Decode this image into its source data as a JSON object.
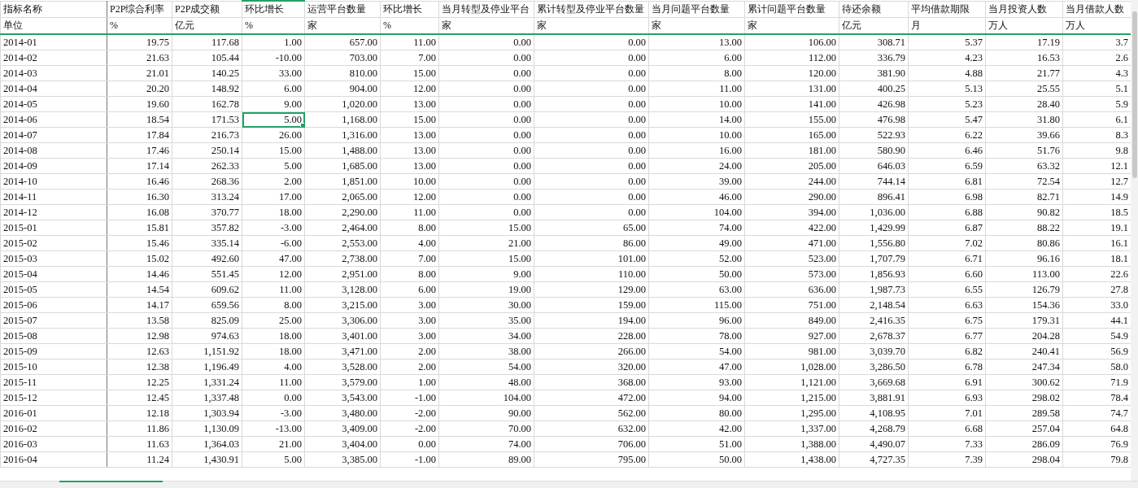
{
  "columns": [
    {
      "name": "指标名称",
      "unit": "单位",
      "selected": false
    },
    {
      "name": "P2P综合利率",
      "unit": "%",
      "selected": false
    },
    {
      "name": "P2P成交额",
      "unit": "亿元",
      "selected": false
    },
    {
      "name": "环比增长",
      "unit": "%",
      "selected": true
    },
    {
      "name": "运营平台数量",
      "unit": "家",
      "selected": false
    },
    {
      "name": "环比增长",
      "unit": "%",
      "selected": false
    },
    {
      "name": "当月转型及停业平台",
      "unit": "家",
      "selected": false
    },
    {
      "name": "累计转型及停业平台数量",
      "unit": "家",
      "selected": false
    },
    {
      "name": "当月问题平台数量",
      "unit": "家",
      "selected": false
    },
    {
      "name": "累计问题平台数量",
      "unit": "家",
      "selected": false
    },
    {
      "name": "待还余额",
      "unit": "亿元",
      "selected": false
    },
    {
      "name": "平均借款期限",
      "unit": "月",
      "selected": false
    },
    {
      "name": "当月投资人数",
      "unit": "万人",
      "selected": false
    },
    {
      "name": "当月借款人数",
      "unit": "万人",
      "selected": false
    }
  ],
  "rows": [
    {
      "selected": false,
      "cells": [
        "2014-01",
        "19.75",
        "117.68",
        "1.00",
        "657.00",
        "11.00",
        "0.00",
        "0.00",
        "13.00",
        "106.00",
        "308.71",
        "5.37",
        "17.19",
        "3.7"
      ]
    },
    {
      "selected": false,
      "cells": [
        "2014-02",
        "21.63",
        "105.44",
        "-10.00",
        "703.00",
        "7.00",
        "0.00",
        "0.00",
        "6.00",
        "112.00",
        "336.79",
        "4.23",
        "16.53",
        "2.6"
      ]
    },
    {
      "selected": false,
      "cells": [
        "2014-03",
        "21.01",
        "140.25",
        "33.00",
        "810.00",
        "15.00",
        "0.00",
        "0.00",
        "8.00",
        "120.00",
        "381.90",
        "4.88",
        "21.77",
        "4.3"
      ]
    },
    {
      "selected": false,
      "cells": [
        "2014-04",
        "20.20",
        "148.92",
        "6.00",
        "904.00",
        "12.00",
        "0.00",
        "0.00",
        "11.00",
        "131.00",
        "400.25",
        "5.13",
        "25.55",
        "5.1"
      ]
    },
    {
      "selected": false,
      "cells": [
        "2014-05",
        "19.60",
        "162.78",
        "9.00",
        "1,020.00",
        "13.00",
        "0.00",
        "0.00",
        "10.00",
        "141.00",
        "426.98",
        "5.23",
        "28.40",
        "5.9"
      ]
    },
    {
      "selected": true,
      "cells": [
        "2014-06",
        "18.54",
        "171.53",
        "5.00",
        "1,168.00",
        "15.00",
        "0.00",
        "0.00",
        "14.00",
        "155.00",
        "476.98",
        "5.47",
        "31.80",
        "6.1"
      ]
    },
    {
      "selected": false,
      "cells": [
        "2014-07",
        "17.84",
        "216.73",
        "26.00",
        "1,316.00",
        "13.00",
        "0.00",
        "0.00",
        "10.00",
        "165.00",
        "522.93",
        "6.22",
        "39.66",
        "8.3"
      ]
    },
    {
      "selected": false,
      "cells": [
        "2014-08",
        "17.46",
        "250.14",
        "15.00",
        "1,488.00",
        "13.00",
        "0.00",
        "0.00",
        "16.00",
        "181.00",
        "580.90",
        "6.46",
        "51.76",
        "9.8"
      ]
    },
    {
      "selected": false,
      "cells": [
        "2014-09",
        "17.14",
        "262.33",
        "5.00",
        "1,685.00",
        "13.00",
        "0.00",
        "0.00",
        "24.00",
        "205.00",
        "646.03",
        "6.59",
        "63.32",
        "12.1"
      ]
    },
    {
      "selected": false,
      "cells": [
        "2014-10",
        "16.46",
        "268.36",
        "2.00",
        "1,851.00",
        "10.00",
        "0.00",
        "0.00",
        "39.00",
        "244.00",
        "744.14",
        "6.81",
        "72.54",
        "12.7"
      ]
    },
    {
      "selected": false,
      "cells": [
        "2014-11",
        "16.30",
        "313.24",
        "17.00",
        "2,065.00",
        "12.00",
        "0.00",
        "0.00",
        "46.00",
        "290.00",
        "896.41",
        "6.98",
        "82.71",
        "14.9"
      ]
    },
    {
      "selected": false,
      "cells": [
        "2014-12",
        "16.08",
        "370.77",
        "18.00",
        "2,290.00",
        "11.00",
        "0.00",
        "0.00",
        "104.00",
        "394.00",
        "1,036.00",
        "6.88",
        "90.82",
        "18.5"
      ]
    },
    {
      "selected": false,
      "cells": [
        "2015-01",
        "15.81",
        "357.82",
        "-3.00",
        "2,464.00",
        "8.00",
        "15.00",
        "65.00",
        "74.00",
        "422.00",
        "1,429.99",
        "6.87",
        "88.22",
        "19.1"
      ]
    },
    {
      "selected": false,
      "cells": [
        "2015-02",
        "15.46",
        "335.14",
        "-6.00",
        "2,553.00",
        "4.00",
        "21.00",
        "86.00",
        "49.00",
        "471.00",
        "1,556.80",
        "7.02",
        "80.86",
        "16.1"
      ]
    },
    {
      "selected": false,
      "cells": [
        "2015-03",
        "15.02",
        "492.60",
        "47.00",
        "2,738.00",
        "7.00",
        "15.00",
        "101.00",
        "52.00",
        "523.00",
        "1,707.79",
        "6.71",
        "96.16",
        "18.1"
      ]
    },
    {
      "selected": false,
      "cells": [
        "2015-04",
        "14.46",
        "551.45",
        "12.00",
        "2,951.00",
        "8.00",
        "9.00",
        "110.00",
        "50.00",
        "573.00",
        "1,856.93",
        "6.60",
        "113.00",
        "22.6"
      ]
    },
    {
      "selected": false,
      "cells": [
        "2015-05",
        "14.54",
        "609.62",
        "11.00",
        "3,128.00",
        "6.00",
        "19.00",
        "129.00",
        "63.00",
        "636.00",
        "1,987.73",
        "6.55",
        "126.79",
        "27.8"
      ]
    },
    {
      "selected": false,
      "cells": [
        "2015-06",
        "14.17",
        "659.56",
        "8.00",
        "3,215.00",
        "3.00",
        "30.00",
        "159.00",
        "115.00",
        "751.00",
        "2,148.54",
        "6.63",
        "154.36",
        "33.0"
      ]
    },
    {
      "selected": false,
      "cells": [
        "2015-07",
        "13.58",
        "825.09",
        "25.00",
        "3,306.00",
        "3.00",
        "35.00",
        "194.00",
        "96.00",
        "849.00",
        "2,416.35",
        "6.75",
        "179.31",
        "44.1"
      ]
    },
    {
      "selected": false,
      "cells": [
        "2015-08",
        "12.98",
        "974.63",
        "18.00",
        "3,401.00",
        "3.00",
        "34.00",
        "228.00",
        "78.00",
        "927.00",
        "2,678.37",
        "6.77",
        "204.28",
        "54.9"
      ]
    },
    {
      "selected": false,
      "cells": [
        "2015-09",
        "12.63",
        "1,151.92",
        "18.00",
        "3,471.00",
        "2.00",
        "38.00",
        "266.00",
        "54.00",
        "981.00",
        "3,039.70",
        "6.82",
        "240.41",
        "56.9"
      ]
    },
    {
      "selected": false,
      "cells": [
        "2015-10",
        "12.38",
        "1,196.49",
        "4.00",
        "3,528.00",
        "2.00",
        "54.00",
        "320.00",
        "47.00",
        "1,028.00",
        "3,286.50",
        "6.78",
        "247.34",
        "58.0"
      ]
    },
    {
      "selected": false,
      "cells": [
        "2015-11",
        "12.25",
        "1,331.24",
        "11.00",
        "3,579.00",
        "1.00",
        "48.00",
        "368.00",
        "93.00",
        "1,121.00",
        "3,669.68",
        "6.91",
        "300.62",
        "71.9"
      ]
    },
    {
      "selected": false,
      "cells": [
        "2015-12",
        "12.45",
        "1,337.48",
        "0.00",
        "3,543.00",
        "-1.00",
        "104.00",
        "472.00",
        "94.00",
        "1,215.00",
        "3,881.91",
        "6.93",
        "298.02",
        "78.4"
      ]
    },
    {
      "selected": false,
      "cells": [
        "2016-01",
        "12.18",
        "1,303.94",
        "-3.00",
        "3,480.00",
        "-2.00",
        "90.00",
        "562.00",
        "80.00",
        "1,295.00",
        "4,108.95",
        "7.01",
        "289.58",
        "74.7"
      ]
    },
    {
      "selected": false,
      "cells": [
        "2016-02",
        "11.86",
        "1,130.09",
        "-13.00",
        "3,409.00",
        "-2.00",
        "70.00",
        "632.00",
        "42.00",
        "1,337.00",
        "4,268.79",
        "6.68",
        "257.04",
        "64.8"
      ]
    },
    {
      "selected": false,
      "cells": [
        "2016-03",
        "11.63",
        "1,364.03",
        "21.00",
        "3,404.00",
        "0.00",
        "74.00",
        "706.00",
        "51.00",
        "1,388.00",
        "4,490.07",
        "7.33",
        "286.09",
        "76.9"
      ]
    },
    {
      "selected": false,
      "cells": [
        "2016-04",
        "11.24",
        "1,430.91",
        "5.00",
        "3,385.00",
        "-1.00",
        "89.00",
        "795.00",
        "50.00",
        "1,438.00",
        "4,727.35",
        "7.39",
        "298.04",
        "79.8"
      ]
    }
  ]
}
